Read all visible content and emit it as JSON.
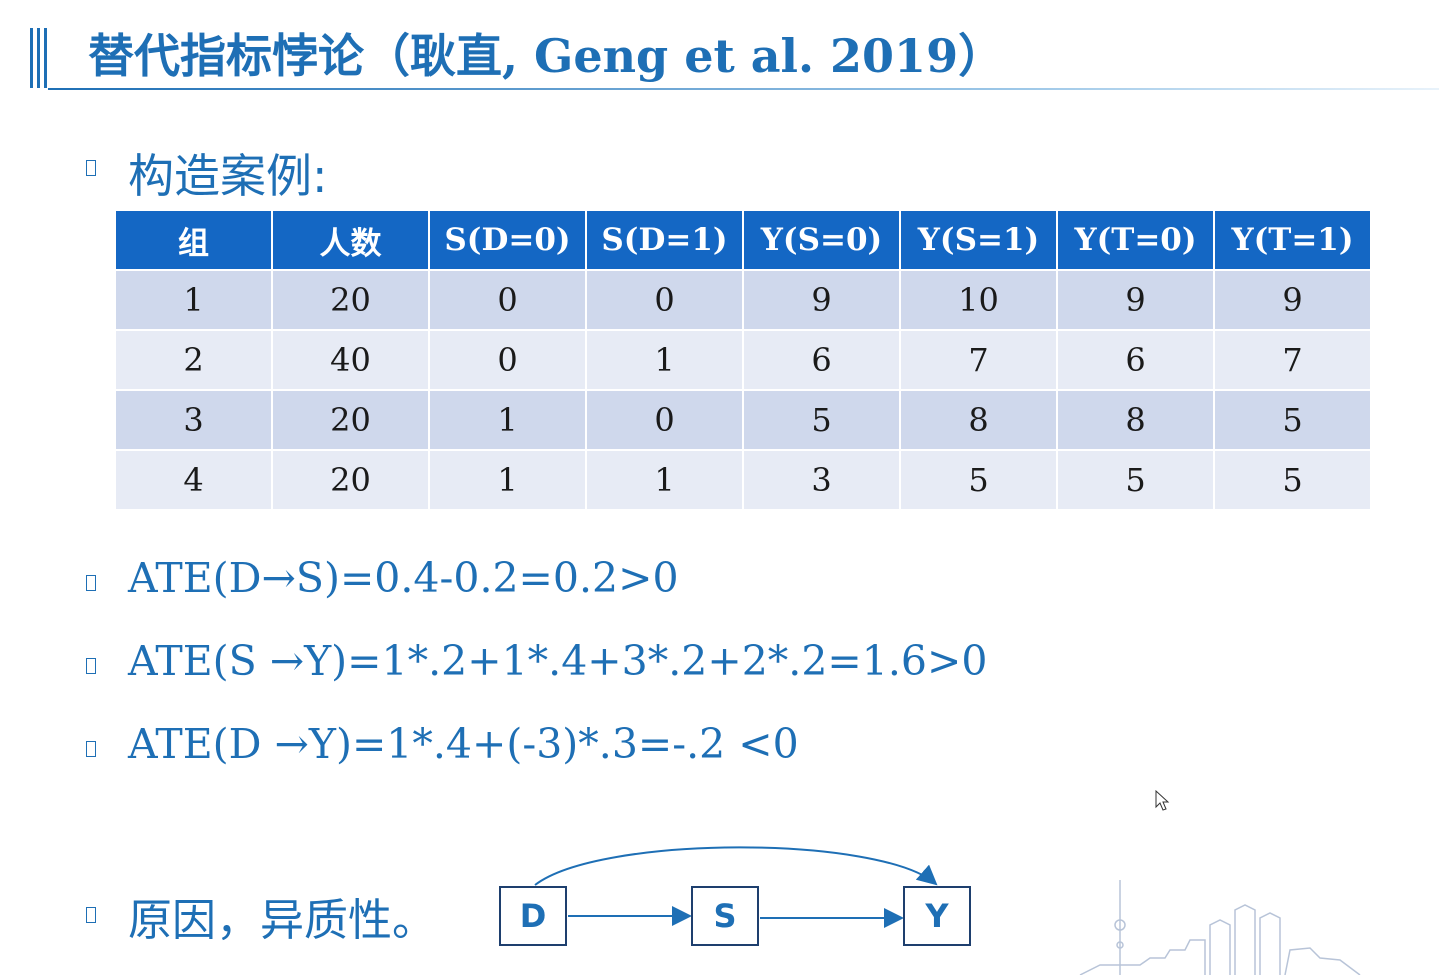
{
  "slide": {
    "title": "替代指标悖论（耿直, Geng et al. 2019）",
    "heading": "构造案例:",
    "table": {
      "headers": [
        "组",
        "人数",
        "S(D=0)",
        "S(D=1)",
        "Y(S=0)",
        "Y(S=1)",
        "Y(T=0)",
        "Y(T=1)"
      ],
      "rows": [
        [
          "1",
          "20",
          "0",
          "0",
          "9",
          "10",
          "9",
          "9"
        ],
        [
          "2",
          "40",
          "0",
          "1",
          "6",
          "7",
          "6",
          "7"
        ],
        [
          "3",
          "20",
          "1",
          "0",
          "5",
          "8",
          "8",
          "5"
        ],
        [
          "4",
          "20",
          "1",
          "1",
          "3",
          "5",
          "5",
          "5"
        ]
      ]
    },
    "formulas": [
      "ATE(D→S)=0.4-0.2=0.2>0",
      "ATE(S →Y)=1*.2+1*.4+3*.2+2*.2=1.6>0",
      "ATE(D →Y)=1*.4+(-3)*.3=-.2 <0"
    ],
    "reason": "原因，异质性。",
    "diagram": {
      "nodes": [
        "D",
        "S",
        "Y"
      ]
    },
    "colors": {
      "accent": "#1e6fb5",
      "table_header": "#1467c4",
      "row_dark": "#cfd8ec",
      "row_light": "#e7ebf5"
    }
  }
}
